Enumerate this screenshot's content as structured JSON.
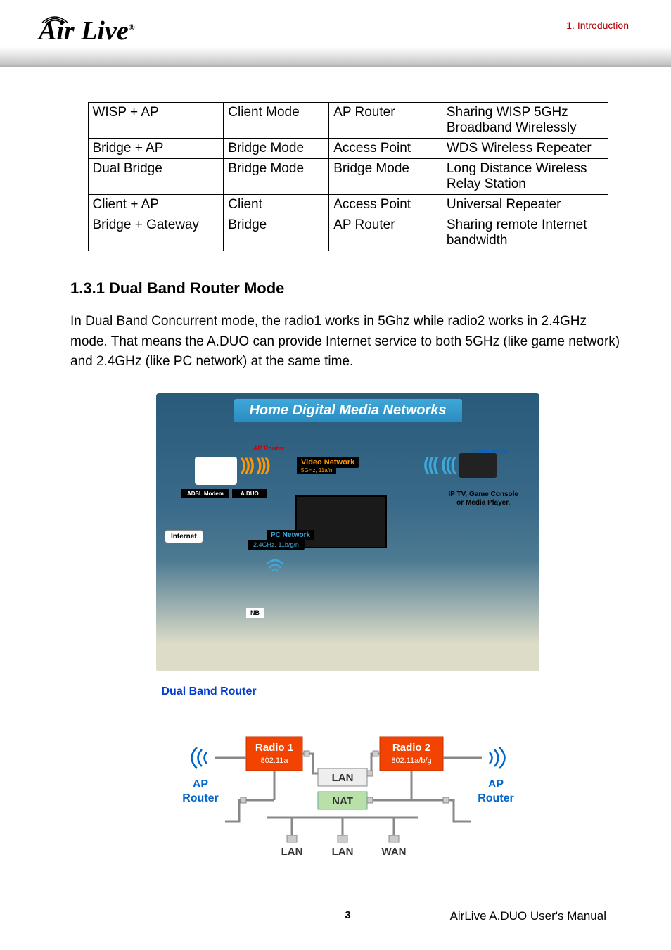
{
  "header": {
    "chapter_label": "1.  Introduction",
    "logo_text": "Air Live",
    "logo_reg": "®"
  },
  "mode_table": {
    "rows": [
      {
        "c1": "WISP + AP",
        "c2": "Client Mode",
        "c3": "AP Router",
        "c4": "Sharing WISP 5GHz Broadband Wirelessly"
      },
      {
        "c1": "Bridge + AP",
        "c2": "Bridge Mode",
        "c3": "Access Point",
        "c4": "WDS Wireless Repeater"
      },
      {
        "c1": "Dual Bridge",
        "c2": "Bridge Mode",
        "c3": "Bridge Mode",
        "c4": "Long Distance Wireless Relay Station"
      },
      {
        "c1": "Client + AP",
        "c2": "Client",
        "c3": "Access Point",
        "c4": "Universal Repeater"
      },
      {
        "c1": "Bridge + Gateway",
        "c2": "Bridge",
        "c3": "AP Router",
        "c4": "Sharing remote Internet bandwidth"
      }
    ]
  },
  "section": {
    "heading": "1.3.1 Dual Band Router Mode",
    "body": "In Dual Band Concurrent mode, the radio1 works in 5Ghz while radio2 works in 2.4GHz mode.    That means the A.DUO can provide Internet service to both 5GHz (like game network) and 2.4GHz (like PC network) at the same time."
  },
  "promo": {
    "title": "Home Digital Media Networks",
    "ap_router": "AP Router",
    "client_mode": "Client Mode",
    "video_network": "Video Network",
    "video_sub": "5GHz, 11a/n",
    "adsl_modem": "ADSL Modem",
    "aduo": "A.DUO",
    "iptv_line1": "IP TV, Game Console",
    "iptv_line2": "or Media Player.",
    "internet": "Internet",
    "pc_network": "PC Network",
    "pc_sub": "2.4GHz, 11b/g/n",
    "nb": "NB"
  },
  "diagram": {
    "title": "Dual Band Router",
    "radio1": "Radio 1",
    "radio1_sub": "802.11a",
    "radio2": "Radio 2",
    "radio2_sub": "802.11a/b/g",
    "ap_left": "AP",
    "router_left": "Router",
    "ap_right": "AP",
    "router_right": "Router",
    "lan": "LAN",
    "nat": "NAT",
    "port_lan": "LAN",
    "port_wan": "WAN"
  },
  "footer": {
    "page_number": "3",
    "manual": "AirLive A.DUO User's Manual"
  }
}
